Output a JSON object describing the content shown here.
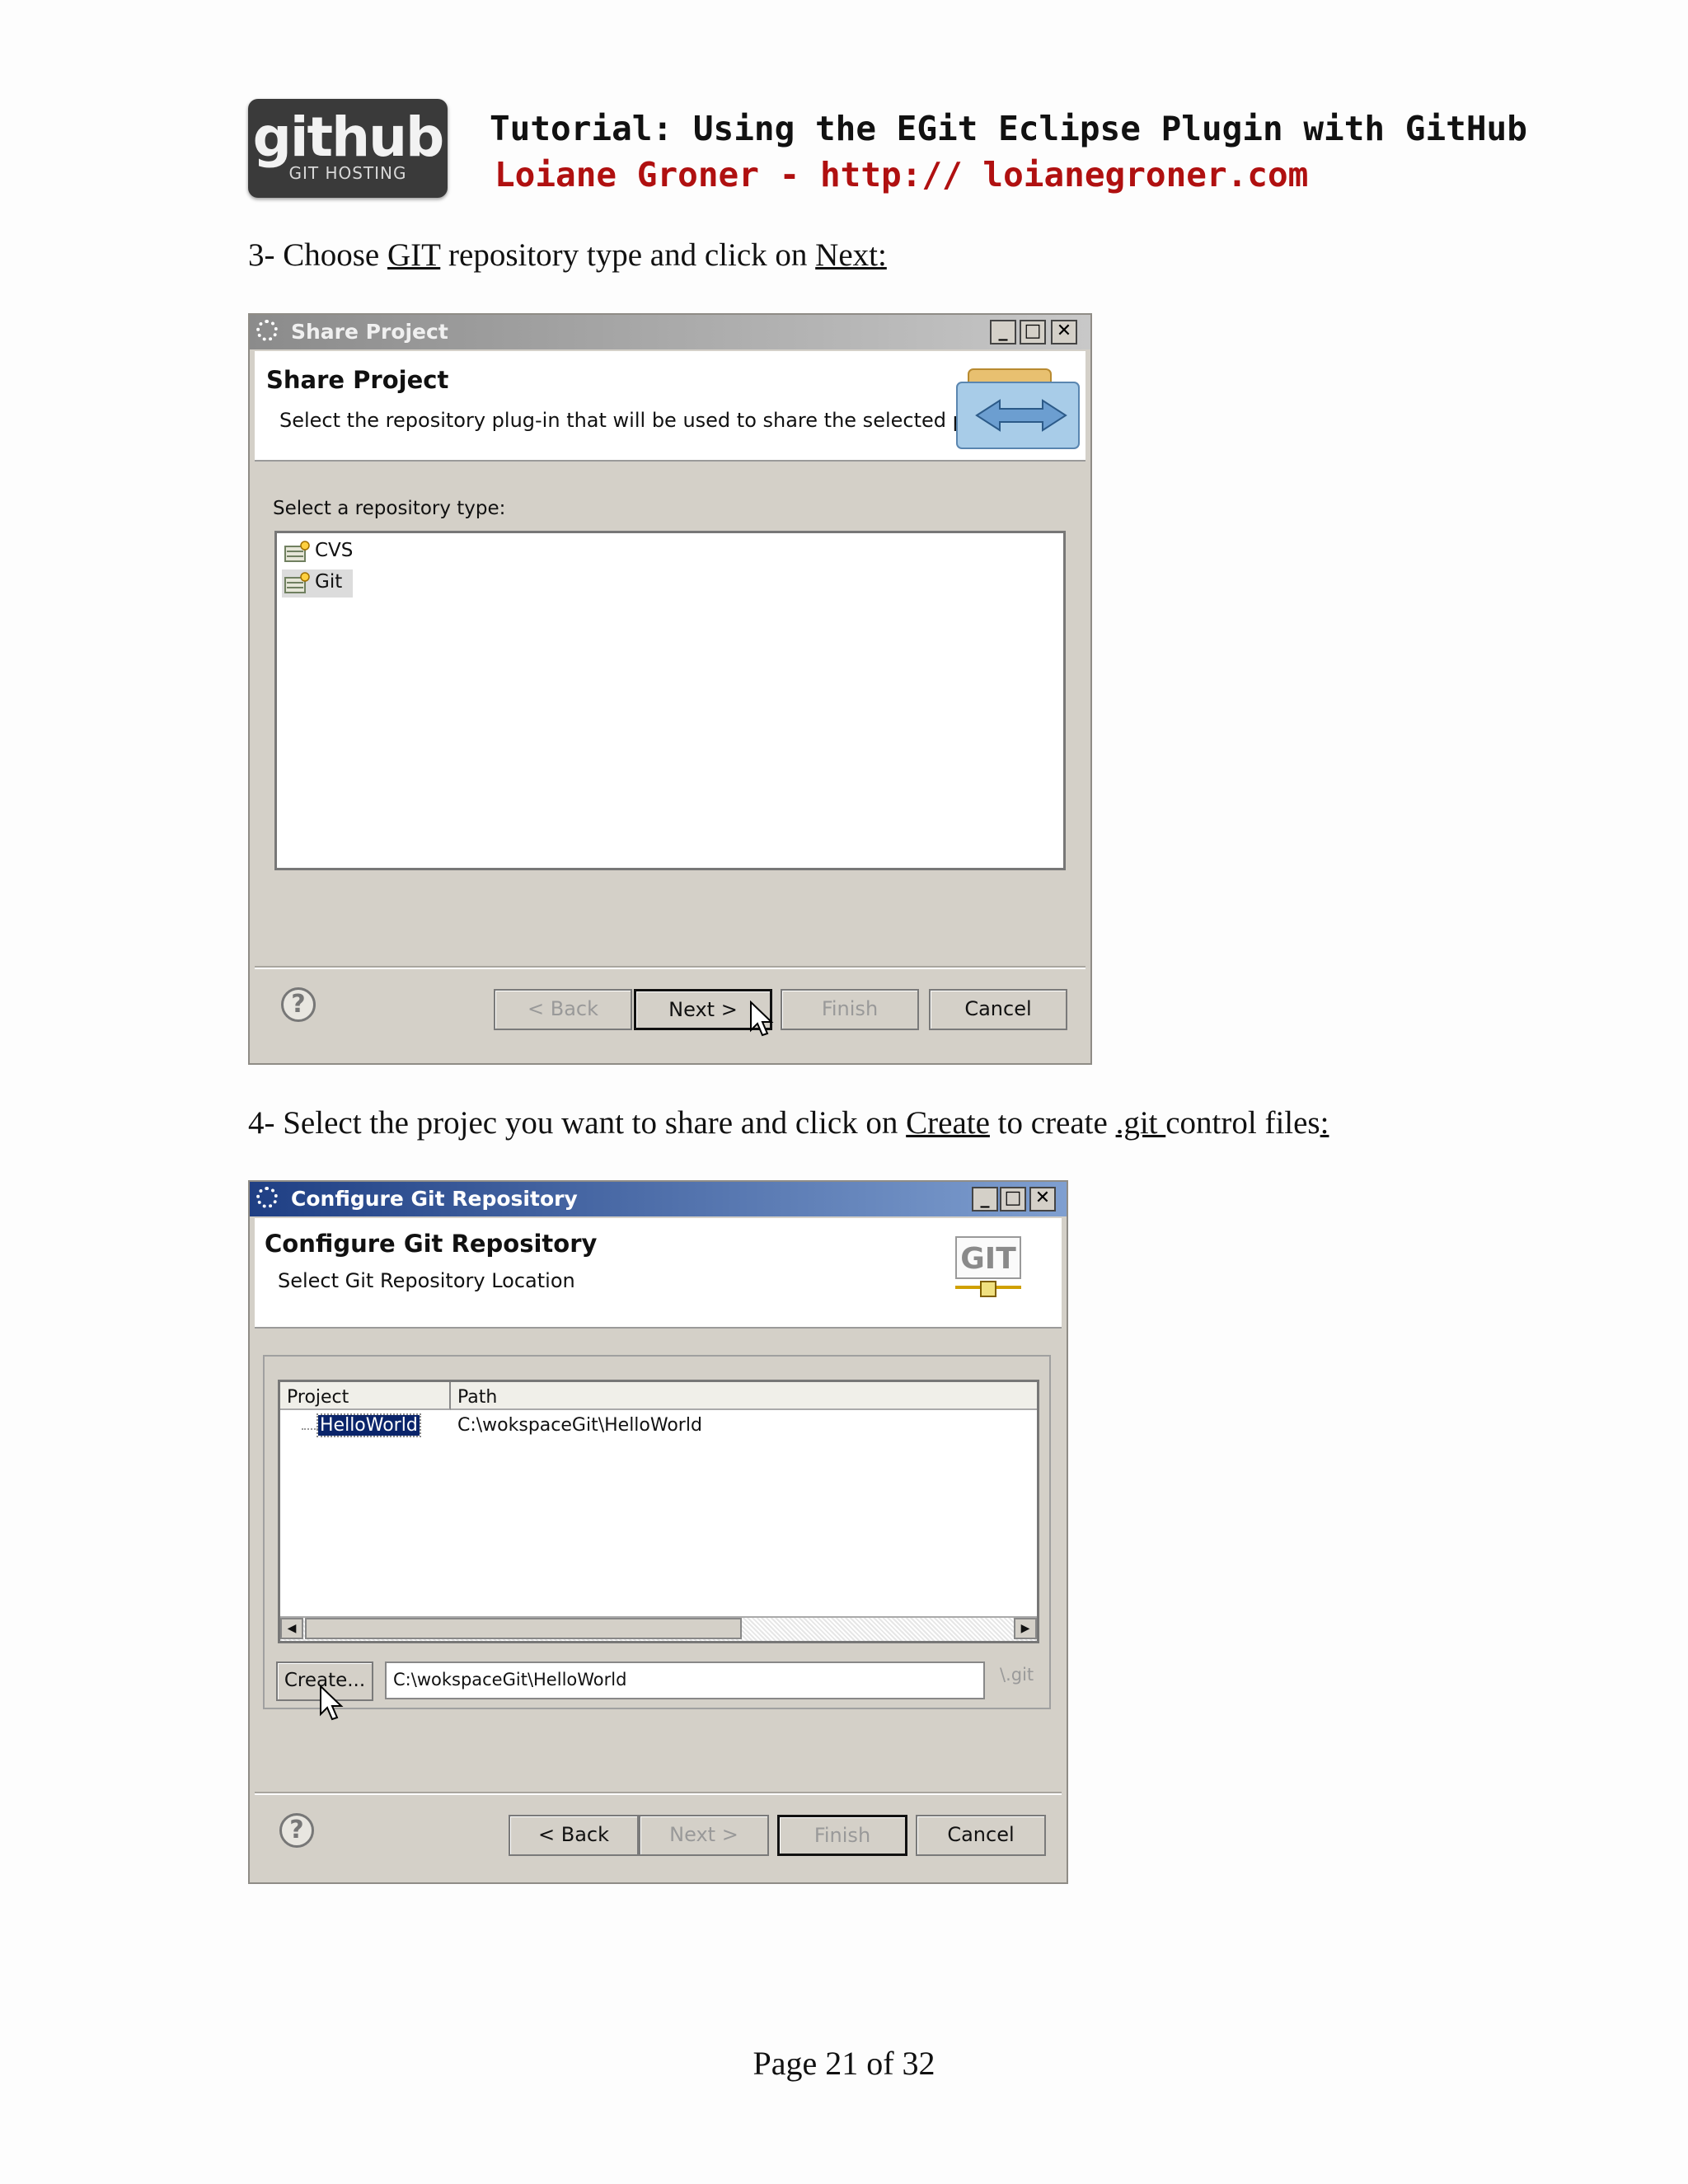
{
  "header": {
    "logo_main": "github",
    "logo_sub": "GIT HOSTING",
    "title": "Tutorial: Using the EGit Eclipse Plugin with GitHub",
    "subtitle": "Loiane Groner - http:// loianegroner.com"
  },
  "step3": {
    "pre": "3- Choose ",
    "git": "GIT",
    "mid": " repository type and click on ",
    "next": "Next:"
  },
  "share_dialog": {
    "window_title": "Share Project",
    "heading": "Share Project",
    "description": "Select the repository plug-in that will be used to share the selected project.",
    "list_label": "Select a repository type:",
    "items": [
      {
        "label": "CVS",
        "icon": "cvs-icon"
      },
      {
        "label": "Git",
        "icon": "git-icon"
      }
    ],
    "buttons": {
      "back": "< Back",
      "next": "Next >",
      "finish": "Finish",
      "cancel": "Cancel"
    },
    "help": "?"
  },
  "step4": {
    "pre": "4- Select the projec you want to share and click on ",
    "create": "Create",
    "mid": " to create ",
    "git": ".git ",
    "post": "control files",
    "colon": ":"
  },
  "config_dialog": {
    "window_title": "Configure Git Repository",
    "heading": "Configure Git Repository",
    "description": "Select Git Repository Location",
    "logo_text": "GIT",
    "columns": [
      "Project",
      "Path"
    ],
    "rows": [
      {
        "project": "HelloWorld",
        "path": "C:\\wokspaceGit\\HelloWorld"
      }
    ],
    "create_button": "Create...",
    "location_value": "C:\\wokspaceGit\\HelloWorld",
    "suffix": "\\.git",
    "buttons": {
      "back": "< Back",
      "next": "Next >",
      "finish": "Finish",
      "cancel": "Cancel"
    },
    "help": "?"
  },
  "footer": {
    "page": "Page 21 of 32"
  },
  "colors": {
    "title_red": "#b01010",
    "active_title": "#2a4e94",
    "inactive_title": "#8e8e8e",
    "dialog_bg": "#d4d0c8"
  }
}
